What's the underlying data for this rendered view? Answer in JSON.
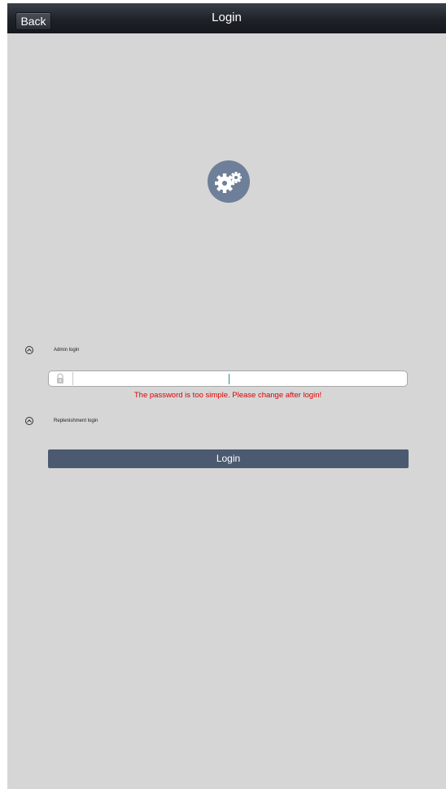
{
  "header": {
    "back_label": "Back",
    "title": "Login"
  },
  "logo": {
    "icon": "gears-icon",
    "color": "#6e7f99"
  },
  "login_modes": [
    {
      "label": "Admin login"
    },
    {
      "label": "Replenishment login"
    }
  ],
  "password": {
    "value": "",
    "placeholder": "",
    "icon": "lock-icon",
    "error": "The password is too simple. Please change after login!"
  },
  "submit": {
    "label": "Login"
  },
  "colors": {
    "background": "#d6d6d6",
    "topbar": "#1e2228",
    "button": "#4b5a70",
    "error": "#e00000"
  }
}
